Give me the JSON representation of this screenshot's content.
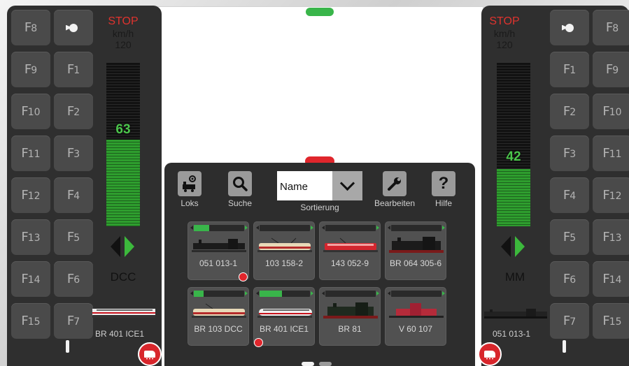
{
  "left_panel": {
    "stop_label": "STOP",
    "unit_label": "km/h",
    "max_speed": "120",
    "speed_value": "63",
    "speed_fraction": 0.53,
    "protocol": "DCC",
    "loco_name": "BR 401 ICE1",
    "function_keys": [
      "F8",
      "F9",
      "F10",
      "F11",
      "F12",
      "F13",
      "F14",
      "F15",
      "F1",
      "F2",
      "F3",
      "F4",
      "F5",
      "F6",
      "F7"
    ]
  },
  "right_panel": {
    "stop_label": "STOP",
    "unit_label": "km/h",
    "max_speed": "120",
    "speed_value": "42",
    "speed_fraction": 0.35,
    "protocol": "MM",
    "loco_name": "051 013-1",
    "function_keys": [
      "F1",
      "F2",
      "F3",
      "F4",
      "F5",
      "F6",
      "F7",
      "F8",
      "F9",
      "F10",
      "F11",
      "F12",
      "F13",
      "F14",
      "F15"
    ]
  },
  "toolbar": {
    "loks_label": "Loks",
    "suche_label": "Suche",
    "sort_value": "Name",
    "sort_label": "Sortierung",
    "bearbeiten_label": "Bearbeiten",
    "hilfe_label": "Hilfe"
  },
  "locos": [
    {
      "name": "051 013-1",
      "speed": 0.3,
      "active": true,
      "image": "steam-loco"
    },
    {
      "name": "103 158-2",
      "speed": 0.0,
      "active": false,
      "image": "electric-loco-cream"
    },
    {
      "name": "143 052-9",
      "speed": 0.0,
      "active": false,
      "image": "electric-loco-red"
    },
    {
      "name": "BR 064 305-6",
      "speed": 0.0,
      "active": false,
      "image": "steam-loco-tank"
    },
    {
      "name": "BR 103 DCC",
      "speed": 0.2,
      "active": false,
      "image": "electric-loco-cream"
    },
    {
      "name": "BR 401 ICE1",
      "speed": 0.45,
      "active": true,
      "image": "ice-train"
    },
    {
      "name": "BR 81",
      "speed": 0.0,
      "active": false,
      "image": "steam-loco-tank"
    },
    {
      "name": "V 60 107",
      "speed": 0.0,
      "active": false,
      "image": "diesel-loco-red"
    }
  ],
  "colors": {
    "accent_green": "#39b54a",
    "stop_red": "#e0332e",
    "panel": "#2f2f2f"
  }
}
